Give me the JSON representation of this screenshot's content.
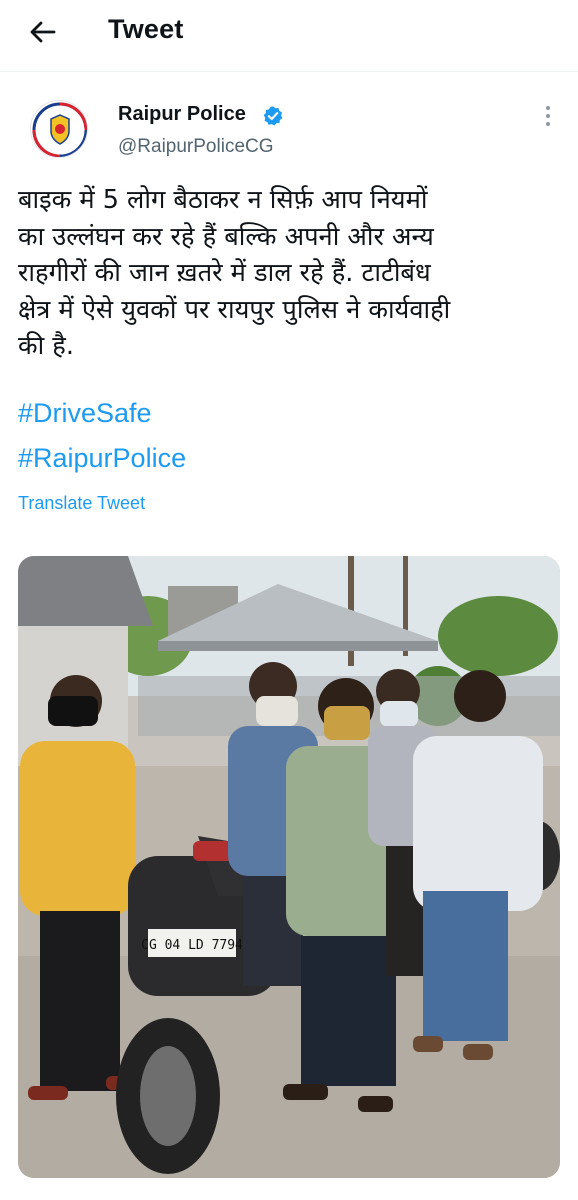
{
  "header": {
    "title": "Tweet",
    "back_icon": "arrow-left-icon"
  },
  "tweet": {
    "author_name": "Raipur Police",
    "author_handle": "@RaipurPoliceCG",
    "verified": true,
    "text_lines": [
      "बाइक में 5 लोग बैठाकर न सिर्फ़ आप नियमों",
      "का उल्लंघन कर रहे हैं बल्कि अपनी और अन्य",
      "राहगीरों की जान ख़तरे में डाल रहे हैं. टाटीबंध",
      "क्षेत्र में ऐसे युवकों पर रायपुर पुलिस ने कार्यवाही",
      "की है."
    ],
    "hashtags": [
      "#DriveSafe",
      "#RaipurPolice"
    ],
    "translate_label": "Translate Tweet",
    "photo": {
      "license_plate": "CG 04 LD 7794"
    }
  },
  "colors": {
    "link": "#1d9bf0",
    "secondary_text": "#536471",
    "verified_badge": "#1d9bf0"
  }
}
